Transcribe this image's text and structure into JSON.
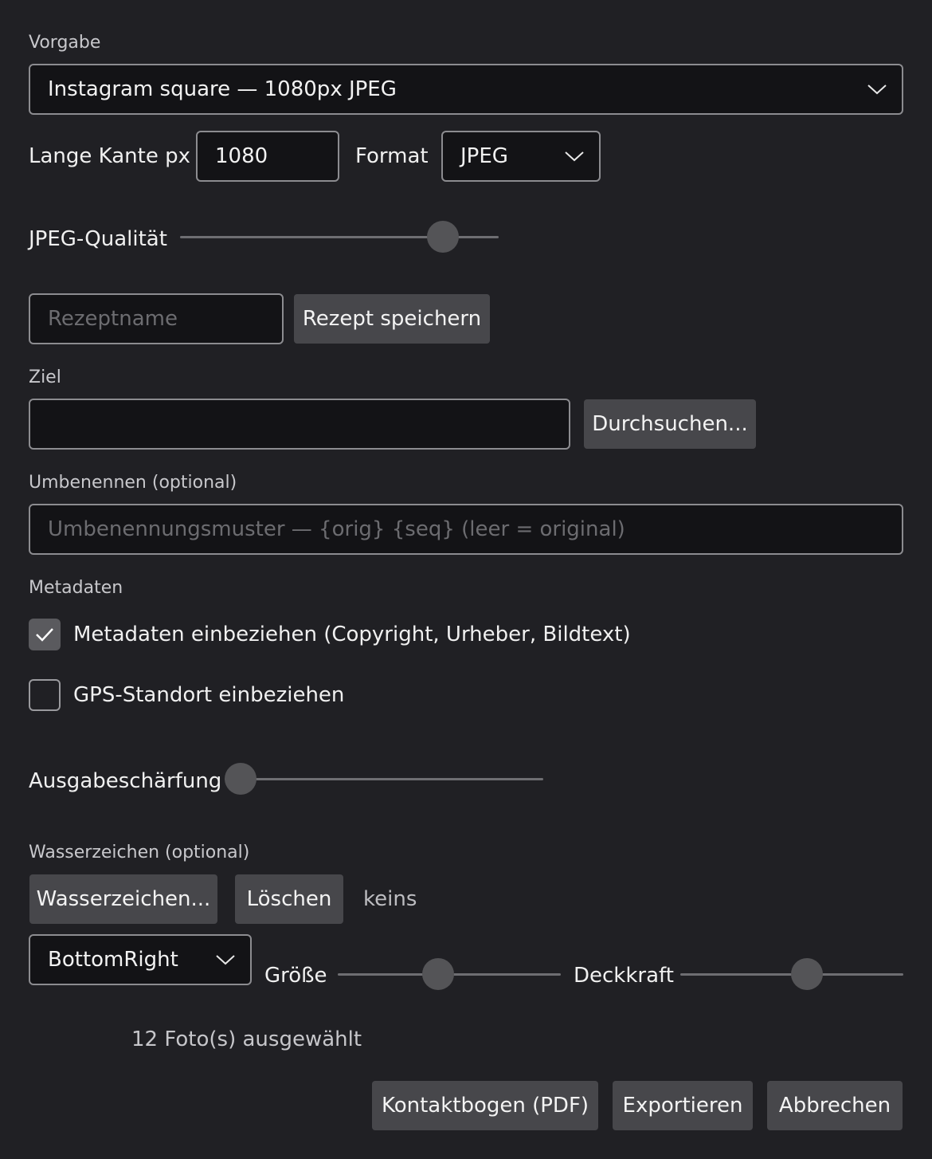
{
  "preset": {
    "label": "Vorgabe",
    "value": "Instagram square — 1080px JPEG"
  },
  "size": {
    "long_edge_label": "Lange Kante px",
    "long_edge_value": "1080",
    "format_label": "Format",
    "format_value": "JPEG"
  },
  "quality": {
    "label": "JPEG-Qualität",
    "value_fraction": 0.86
  },
  "recipe": {
    "name_placeholder": "Rezeptname",
    "save_label": "Rezept speichern"
  },
  "target": {
    "label": "Ziel",
    "value": "",
    "browse_label": "Durchsuchen..."
  },
  "rename": {
    "label": "Umbenennen (optional)",
    "placeholder": "Umbenennungsmuster — {orig} {seq} (leer = original)"
  },
  "metadata": {
    "label": "Metadaten",
    "include_label": "Metadaten einbeziehen (Copyright, Urheber, Bildtext)",
    "include_checked": true,
    "gps_label": "GPS-Standort einbeziehen",
    "gps_checked": false
  },
  "sharpening": {
    "label": "Ausgabeschärfung",
    "value_fraction": 0.0
  },
  "watermark": {
    "label": "Wasserzeichen (optional)",
    "choose_label": "Wasserzeichen...",
    "clear_label": "Löschen",
    "current": "keins",
    "position": "BottomRight",
    "size_label": "Größe",
    "size_fraction": 0.44,
    "opacity_label": "Deckkraft",
    "opacity_fraction": 0.58
  },
  "footer": {
    "selection": "12 Foto(s) ausgewählt",
    "contact_sheet_label": "Kontaktbogen (PDF)",
    "export_label": "Exportieren",
    "cancel_label": "Abbrechen"
  }
}
